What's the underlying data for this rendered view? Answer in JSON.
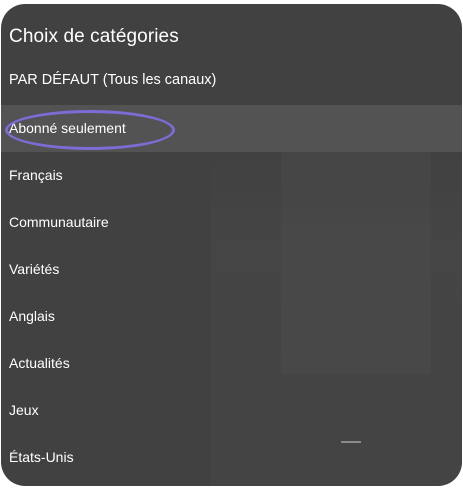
{
  "title": "Choix de catégories",
  "default_option": "PAR DÉFAUT (Tous les canaux)",
  "categories": [
    {
      "label": "Abonné seulement",
      "selected": true
    },
    {
      "label": "Français",
      "selected": false
    },
    {
      "label": "Communautaire",
      "selected": false
    },
    {
      "label": "Variétés",
      "selected": false
    },
    {
      "label": "Anglais",
      "selected": false
    },
    {
      "label": "Actualités",
      "selected": false
    },
    {
      "label": "Jeux",
      "selected": false
    },
    {
      "label": "États-Unis",
      "selected": false
    }
  ],
  "colors": {
    "panel_background": "#414141",
    "selected_row": "#535353",
    "highlight_ring": "#7e6bd6",
    "text": "#ffffff"
  }
}
